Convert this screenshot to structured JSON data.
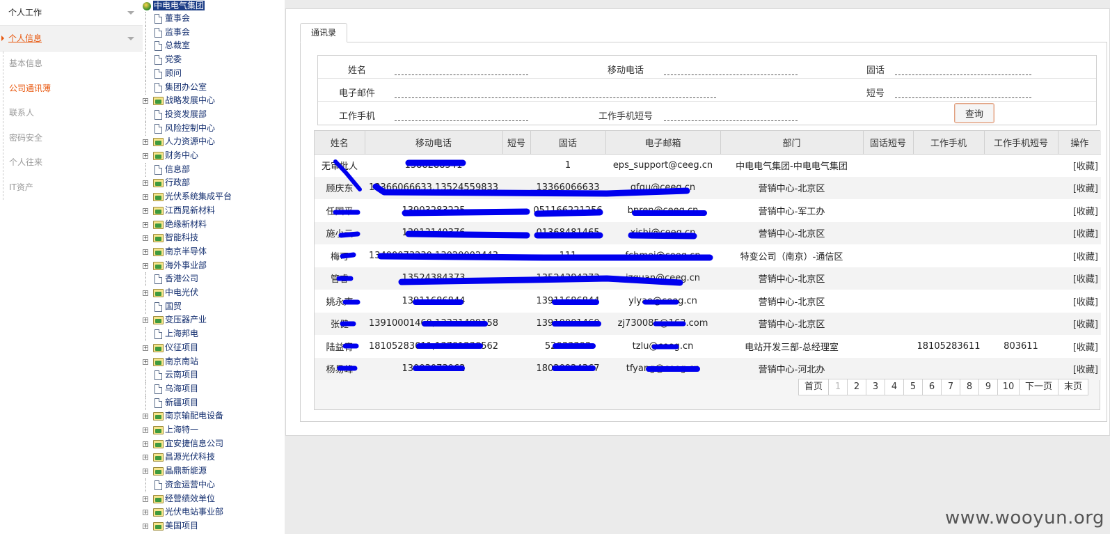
{
  "left_menu": {
    "groups": [
      {
        "label": "个人工作"
      },
      {
        "label": "个人信息"
      }
    ],
    "sub_items": [
      {
        "label": "基本信息"
      },
      {
        "label": "公司通讯薄"
      },
      {
        "label": "联系人"
      },
      {
        "label": "密码安全"
      },
      {
        "label": "个人往来"
      },
      {
        "label": "IT资产"
      }
    ]
  },
  "tree": {
    "root": "中电电气集团",
    "nodes": [
      {
        "label": "董事会",
        "folder": false
      },
      {
        "label": "监事会",
        "folder": false
      },
      {
        "label": "总裁室",
        "folder": false
      },
      {
        "label": "党委",
        "folder": false
      },
      {
        "label": "顾问",
        "folder": false
      },
      {
        "label": "集团办公室",
        "folder": false
      },
      {
        "label": "战略发展中心",
        "folder": true
      },
      {
        "label": "投资发展部",
        "folder": false
      },
      {
        "label": "风险控制中心",
        "folder": false
      },
      {
        "label": "人力资源中心",
        "folder": true
      },
      {
        "label": "财务中心",
        "folder": true
      },
      {
        "label": "信息部",
        "folder": false
      },
      {
        "label": "行政部",
        "folder": true
      },
      {
        "label": "光伏系统集成平台",
        "folder": true
      },
      {
        "label": "江西晁新材料",
        "folder": true
      },
      {
        "label": "绝缘新材料",
        "folder": true
      },
      {
        "label": "智能科技",
        "folder": true
      },
      {
        "label": "南京半导体",
        "folder": true
      },
      {
        "label": "海外事业部",
        "folder": true
      },
      {
        "label": "香港公司",
        "folder": false
      },
      {
        "label": "中电光伏",
        "folder": true
      },
      {
        "label": "国贸",
        "folder": false
      },
      {
        "label": "变压器产业",
        "folder": true
      },
      {
        "label": "上海邦电",
        "folder": false
      },
      {
        "label": "仪征项目",
        "folder": true
      },
      {
        "label": "南京南站",
        "folder": true
      },
      {
        "label": "云南项目",
        "folder": false
      },
      {
        "label": "乌海项目",
        "folder": false
      },
      {
        "label": "新疆项目",
        "folder": false
      },
      {
        "label": "南京输配电设备",
        "folder": true
      },
      {
        "label": "上海特一",
        "folder": true
      },
      {
        "label": "宜安捷信息公司",
        "folder": true
      },
      {
        "label": "昌源光伏科技",
        "folder": true
      },
      {
        "label": "晶鼎新能源",
        "folder": true
      },
      {
        "label": "资金运营中心",
        "folder": false
      },
      {
        "label": "经营绩效单位",
        "folder": true
      },
      {
        "label": "光伏电站事业部",
        "folder": true
      },
      {
        "label": "美国项目",
        "folder": true
      }
    ]
  },
  "tab": {
    "label": "通讯录"
  },
  "form": {
    "name_label": "姓名",
    "mobile_label": "移动电话",
    "landline_label": "固话",
    "email_label": "电子邮件",
    "short_label": "短号",
    "work_mobile_label": "工作手机",
    "work_short_label": "工作手机短号",
    "query_button": "查询"
  },
  "table": {
    "headers": [
      "姓名",
      "移动电话",
      "短号",
      "固话",
      "电子邮箱",
      "部门",
      "固话短号",
      "工作手机",
      "工作手机短号",
      "操作"
    ],
    "rows": [
      [
        "无审批人",
        "1388288541",
        "",
        "1",
        "eps_support@ceeg.cn",
        "中电电气集团-中电电气集团",
        "",
        "",
        "",
        "[收藏]"
      ],
      [
        "顾庆东",
        "13366066633,13524559833",
        "",
        "13366066633",
        "gfqu@ceeg.cn",
        "营销中心-北京区",
        "",
        "",
        "",
        "[收藏]"
      ],
      [
        "任国平",
        "13903283225",
        "",
        "051166221256",
        "bpren@ceeg.cn",
        "营销中心-军工办",
        "",
        "",
        "",
        "[收藏]"
      ],
      [
        "施小云",
        "13913140376",
        "",
        "01368481465",
        "xishi@ceeg.cn",
        "营销中心-北京区",
        "",
        "",
        "",
        "[收藏]"
      ],
      [
        "梅可",
        "13400073230,13020002443",
        "",
        "111",
        "fchmei@ceeg.cn",
        "特变公司（南京）-通信区",
        "",
        "",
        "",
        "[收藏]"
      ],
      [
        "管睿",
        "13524384373",
        "",
        "13524384373",
        "jzguan@ceeg.cn",
        "营销中心-北京区",
        "",
        "",
        "",
        "[收藏]"
      ],
      [
        "姚永声",
        "13911686844",
        "",
        "13911686844",
        "ylyao@ceeg.cn",
        "营销中心-北京区",
        "",
        "",
        "",
        "[收藏]"
      ],
      [
        "张健",
        "13910001460,13331409158",
        "",
        "13910001460",
        "zj730085@163.com",
        "营销中心-北京区",
        "",
        "",
        "",
        "[收藏]"
      ],
      [
        "陆益青",
        "18105283611,13701230562",
        "",
        "52033303",
        "tzlu@ceeg.cn",
        "电站开发三部-总经理室",
        "",
        "18105283611",
        "803611",
        "[收藏]"
      ],
      [
        "杨易峰",
        "13003073062",
        "",
        "18020924367",
        "tfyang@ceeg.cn",
        "营销中心-河北办",
        "",
        "",
        "",
        "[收藏]"
      ]
    ]
  },
  "pager": {
    "first": "首页",
    "pages": [
      "1",
      "2",
      "3",
      "4",
      "5",
      "6",
      "7",
      "8",
      "9",
      "10"
    ],
    "current": "1",
    "next": "下一页",
    "last": "末页"
  },
  "watermark": "www.wooyun.org",
  "colors": {
    "accent": "#e8560c",
    "scribble": "#0000ee",
    "tree_text": "#122d6e"
  }
}
